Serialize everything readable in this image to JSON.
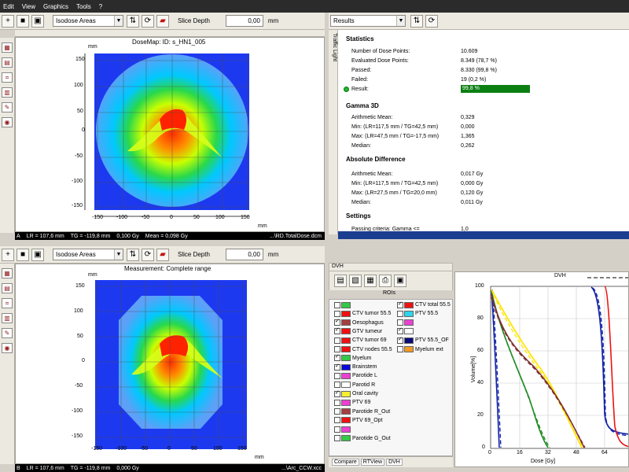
{
  "menu": [
    "Edit",
    "View",
    "Graphics",
    "Tools",
    "?"
  ],
  "top": {
    "mode": "Isodose Areas",
    "slice_label": "Slice Depth",
    "slice_value": "0,00",
    "slice_unit": "mm",
    "title": "DoseMap: ID: s_HN1_005",
    "y_unit": "mm",
    "x_unit": "mm",
    "status": [
      "A",
      "LR = 107,6 mm",
      "TG = -119,8 mm",
      "0,100 Gy",
      "Mean = 0,098 Gy",
      "...\\RD.TotalDose.dcm"
    ]
  },
  "bottom": {
    "mode": "Isodose Areas",
    "slice_label": "Slice Depth",
    "slice_value": "0,00",
    "slice_unit": "mm",
    "title": "Measurement: Complete range",
    "y_unit": "mm",
    "x_unit": "mm",
    "status": [
      "B",
      "LR = 107,6 mm",
      "TG = -119,8 mm",
      "0,000 Gy",
      "...\\Arc_CCW.xcc"
    ]
  },
  "ticks_top": {
    "x": [
      "-150",
      "-100",
      "-50",
      "0",
      "50",
      "100",
      "150"
    ],
    "y": [
      "150",
      "100",
      "50",
      "0",
      "-50",
      "-100",
      "-150"
    ]
  },
  "ticks_bottom": {
    "x": [
      "-150",
      "-100",
      "-50",
      "0",
      "50",
      "100",
      "150"
    ],
    "y": [
      "150",
      "100",
      "50",
      "0",
      "-50",
      "-100",
      "-150"
    ]
  },
  "results": {
    "dropdown": "Results",
    "sidetab": "Traffic Light",
    "statistics_title": "Statistics",
    "statistics": [
      {
        "label": "Number of Dose Points:",
        "value": "10.609"
      },
      {
        "label": "Evaluated Dose Points:",
        "value": "8.349 (78,7 %)"
      },
      {
        "label": "Passed:",
        "value": "8.330 (99,8 %)"
      },
      {
        "label": "Failed:",
        "value": "19 (0,2 %)"
      }
    ],
    "result_label": "Result:",
    "result_value": "99,8 %",
    "gamma_title": "Gamma 3D",
    "gamma": [
      {
        "label": "Arithmetic Mean:",
        "value": "0,329"
      },
      {
        "label": "Min: (LR=117,5 mm / TG=42,5 mm)",
        "value": "0,000"
      },
      {
        "label": "Max: (LR=47,5 mm / TG=-17,5 mm)",
        "value": "1,365"
      },
      {
        "label": "Median:",
        "value": "0,262"
      }
    ],
    "absdiff_title": "Absolute Difference",
    "absdiff": [
      {
        "label": "Arithmetic Mean:",
        "value": "0,017 Gy"
      },
      {
        "label": "Min: (LR=117,5 mm / TG=42,5 mm)",
        "value": "0,000 Gy"
      },
      {
        "label": "Max: (LR=27,5 mm / TG=20,0 mm)",
        "value": "0,120 Gy"
      },
      {
        "label": "Median:",
        "value": "0,011 Gy"
      }
    ],
    "settings_title": "Settings",
    "settings": [
      {
        "label": "Passing criteria: Gamma <=",
        "value": "1,0"
      }
    ]
  },
  "dvh": {
    "panel_title": "DVH",
    "rois_title": "ROIs",
    "tabs": [
      "Compare",
      "RTView",
      "DVH"
    ],
    "rois": [
      {
        "label": "",
        "checked": false,
        "color": "#34c946"
      },
      {
        "label": "CTV tumor 55.5",
        "checked": false,
        "color": "#ef1111"
      },
      {
        "label": "Oesophagus",
        "checked": true,
        "color": "#a43f3f"
      },
      {
        "label": "GTV tumeur",
        "checked": true,
        "color": "#ef1111"
      },
      {
        "label": "CTV tumor 69",
        "checked": false,
        "color": "#ef1111"
      },
      {
        "label": "CTV nodes 55.5",
        "checked": false,
        "color": "#ef1111"
      },
      {
        "label": "Myelum",
        "checked": true,
        "color": "#34c946"
      },
      {
        "label": "Brainstem",
        "checked": true,
        "color": "#0909d8"
      },
      {
        "label": "Parotide L",
        "checked": false,
        "color": "#ec40d3"
      },
      {
        "label": "Parotid R",
        "checked": false,
        "color": "#ffffff"
      },
      {
        "label": "Oral cavity",
        "checked": true,
        "color": "#f8ef2f"
      },
      {
        "label": "PTV 69",
        "checked": false,
        "color": "#ec40d3"
      },
      {
        "label": "Parotide R_Out",
        "checked": false,
        "color": "#a43f3f"
      },
      {
        "label": "PTV 69_Opt",
        "checked": false,
        "color": "#ef1111"
      },
      {
        "label": "",
        "checked": false,
        "color": "#ec40d3"
      },
      {
        "label": "Parotide G_Out",
        "checked": false,
        "color": "#34c946"
      },
      {
        "label": "CTV total 55.5",
        "checked": true,
        "color": "#ef1111"
      },
      {
        "label": "PTV 55.5",
        "checked": false,
        "color": "#29d6ed"
      },
      {
        "label": "",
        "checked": false,
        "color": "#ec40d3"
      },
      {
        "label": "",
        "checked": true,
        "color": "#ffffff"
      },
      {
        "label": "PTV 55.5_OF",
        "checked": true,
        "color": "#0a0a7a"
      },
      {
        "label": "Myelum ext",
        "checked": false,
        "color": "#f29a24"
      }
    ],
    "graph_title": "DVH",
    "x_label": "Dose [Gy]",
    "y_label": "Volume[%]",
    "x_ticks": [
      "0",
      "16",
      "32",
      "48",
      "64"
    ],
    "y_ticks": [
      "100",
      "80",
      "60",
      "40",
      "20",
      "0"
    ]
  }
}
